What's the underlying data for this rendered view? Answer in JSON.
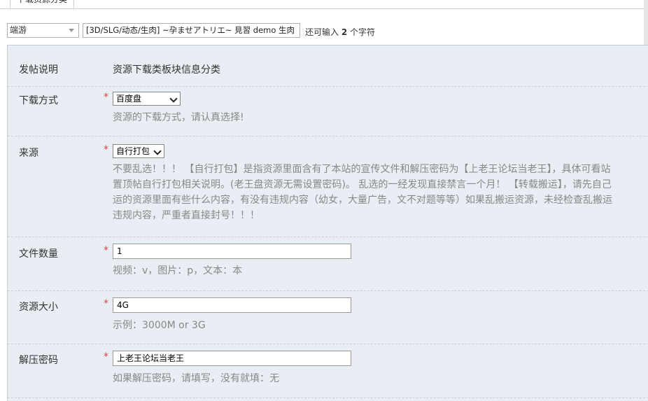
{
  "tab": {
    "label": "下载资源分类"
  },
  "toolbar": {
    "type_select": "端游",
    "title_value": "[3D/SLG/动态/生肉] ~孕ませアトリエ~ 見習 demo 生肉",
    "remain_prefix": "还可输入",
    "remain_count": "2",
    "remain_suffix": "个字符"
  },
  "form": {
    "desc": {
      "label": "发帖说明",
      "value": "资源下载类板块信息分类"
    },
    "download": {
      "label": "下载方式",
      "required": "*",
      "selected": "百度盘",
      "hint": "资源的下载方式，请认真选择!"
    },
    "source": {
      "label": "来源",
      "required": "*",
      "selected": "自行打包",
      "hint_lines": [
        "不要乱选！！！ 【自行打包】是指资源里面含有了本站的宣传文件和解压密码为【上老王论坛当老王】，具体可看站",
        "置顶帖自行打包相关说明。(老王盘资源无需设置密码)。 乱选的一经发现直接禁言一个月！ 【转载搬运】，请先自己",
        "运的资源里面有些什么内容，有没有违规内容（幼女，大量广告，文不对题等等）如果乱搬运资源，未经检查乱搬运",
        "违规内容，严重者直接封号！！！"
      ]
    },
    "file_count": {
      "label": "文件数量",
      "required": "*",
      "value": "1",
      "hint": "视频：v，图片：p，文本：本"
    },
    "size": {
      "label": "资源大小",
      "required": "*",
      "value": "4G",
      "hint": "示例：3000M or 3G"
    },
    "password": {
      "label": "解压密码",
      "required": "*",
      "value": "上老王论坛当老王",
      "hint": "如果解压密码，请填写，没有就填：无"
    }
  }
}
